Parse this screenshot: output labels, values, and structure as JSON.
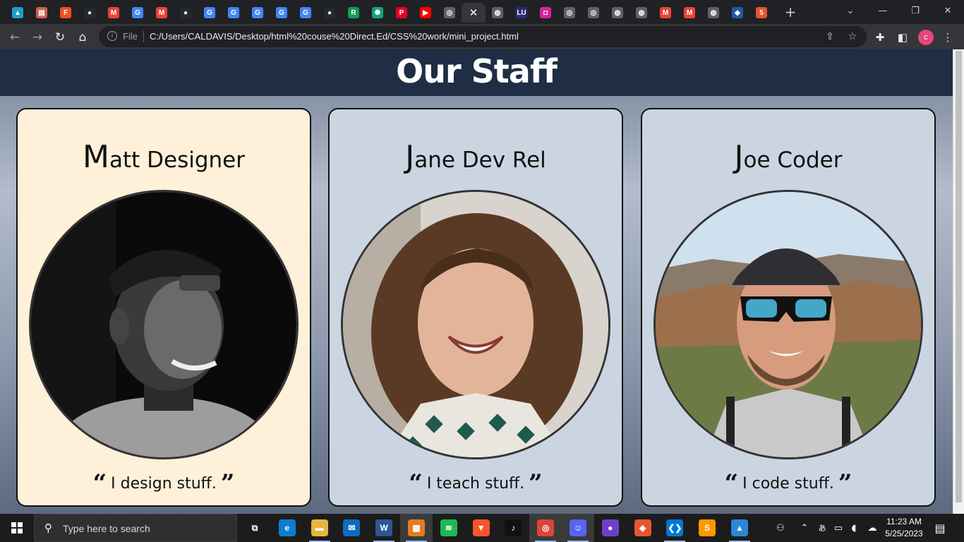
{
  "browser": {
    "tab_close_glyph": "✕",
    "new_tab_glyph": "+",
    "tabs": [
      {
        "icon": "meet-icon",
        "color": "#1aa0c8",
        "glyph": "▲"
      },
      {
        "icon": "notes-icon",
        "color": "#c9634d",
        "glyph": "▤"
      },
      {
        "icon": "figma-icon",
        "color": "#f24e1e",
        "glyph": "F"
      },
      {
        "icon": "github-icon",
        "color": "#24292e",
        "glyph": "●"
      },
      {
        "icon": "gmail-icon",
        "color": "#ea4335",
        "glyph": "M"
      },
      {
        "icon": "google-icon",
        "color": "#4285f4",
        "glyph": "G"
      },
      {
        "icon": "gmail-icon",
        "color": "#ea4335",
        "glyph": "M"
      },
      {
        "icon": "github-icon",
        "color": "#24292e",
        "glyph": "●"
      },
      {
        "icon": "google-icon",
        "color": "#4285f4",
        "glyph": "G"
      },
      {
        "icon": "google-icon",
        "color": "#4285f4",
        "glyph": "G"
      },
      {
        "icon": "google-icon",
        "color": "#4285f4",
        "glyph": "G"
      },
      {
        "icon": "google-icon",
        "color": "#4285f4",
        "glyph": "G"
      },
      {
        "icon": "google-icon",
        "color": "#4285f4",
        "glyph": "G"
      },
      {
        "icon": "github-icon",
        "color": "#24292e",
        "glyph": "●"
      },
      {
        "icon": "replit-icon",
        "color": "#0f9d58",
        "glyph": "R"
      },
      {
        "icon": "chatgpt-icon",
        "color": "#10a37f",
        "glyph": "✺"
      },
      {
        "icon": "pinterest-icon",
        "color": "#e60023",
        "glyph": "P"
      },
      {
        "icon": "youtube-icon",
        "color": "#ff0000",
        "glyph": "▶"
      },
      {
        "icon": "chrome-icon",
        "color": "#5f6368",
        "glyph": "◎"
      },
      {
        "icon": "active-tab-close-icon",
        "color": "#35363a",
        "glyph": "✕"
      },
      {
        "icon": "globe-icon",
        "color": "#5f6368",
        "glyph": "◍"
      },
      {
        "icon": "lu-icon",
        "color": "#2b2b7a",
        "glyph": "LU"
      },
      {
        "icon": "instagram-icon",
        "color": "#d6249f",
        "glyph": "◘"
      },
      {
        "icon": "chrome-icon",
        "color": "#5f6368",
        "glyph": "◎"
      },
      {
        "icon": "chrome-icon",
        "color": "#5f6368",
        "glyph": "◎"
      },
      {
        "icon": "globe-icon",
        "color": "#5f6368",
        "glyph": "◍"
      },
      {
        "icon": "globe-icon",
        "color": "#5f6368",
        "glyph": "◍"
      },
      {
        "icon": "gmail-icon",
        "color": "#ea4335",
        "glyph": "M"
      },
      {
        "icon": "gmail-icon",
        "color": "#ea4335",
        "glyph": "M"
      },
      {
        "icon": "globe-icon",
        "color": "#5f6368",
        "glyph": "◍"
      },
      {
        "icon": "app-icon",
        "color": "#1f5aa6",
        "glyph": "◆"
      },
      {
        "icon": "html-icon",
        "color": "#e5532d",
        "glyph": "5"
      }
    ],
    "omnibox": {
      "info_glyph": "i",
      "scheme_label": "File",
      "url": "C:/Users/CALDAVIS/Desktop/html%20couse%20Direct.Ed/CSS%20work/mini_project.html"
    },
    "profile_initial": "c"
  },
  "page": {
    "title": "Our Staff",
    "staff": [
      {
        "initial": "M",
        "name_rest": "att Designer",
        "quote": "I design stuff.",
        "card_color": "#fef0d9"
      },
      {
        "initial": "J",
        "name_rest": "ane Dev Rel",
        "quote": "I teach stuff.",
        "card_color": "#cbd5e2"
      },
      {
        "initial": "J",
        "name_rest": "oe Coder",
        "quote": "I code stuff.",
        "card_color": "#cbd5e2"
      }
    ],
    "open_quote": "“",
    "close_quote": "”"
  },
  "taskbar": {
    "search_placeholder": "Type here to search",
    "time": "11:23 AM",
    "date": "5/25/2023",
    "apps": [
      {
        "icon": "task-view-icon",
        "color": "#1c1c1c",
        "glyph": "⧉"
      },
      {
        "icon": "edge-icon",
        "color": "#0c7fd1",
        "glyph": "e"
      },
      {
        "icon": "file-explorer-icon",
        "color": "#e8b53f",
        "glyph": "▬"
      },
      {
        "icon": "mail-icon",
        "color": "#0f6cbd",
        "glyph": "✉"
      },
      {
        "icon": "word-icon",
        "color": "#2b579a",
        "glyph": "W"
      },
      {
        "icon": "store-icon",
        "color": "#e57a23",
        "glyph": "▦"
      },
      {
        "icon": "spotify-icon",
        "color": "#1db954",
        "glyph": "≋"
      },
      {
        "icon": "brave-icon",
        "color": "#fb542b",
        "glyph": "▼"
      },
      {
        "icon": "tiktok-icon",
        "color": "#111111",
        "glyph": "♪"
      },
      {
        "icon": "chrome-icon",
        "color": "#db4437",
        "glyph": "◎"
      },
      {
        "icon": "discord-icon",
        "color": "#5865f2",
        "glyph": "☺"
      },
      {
        "icon": "github-desktop-icon",
        "color": "#6e40c9",
        "glyph": "●"
      },
      {
        "icon": "git-icon",
        "color": "#e4572e",
        "glyph": "◈"
      },
      {
        "icon": "vscode-icon",
        "color": "#0078d4",
        "glyph": "❮❯"
      },
      {
        "icon": "sublime-icon",
        "color": "#ff9800",
        "glyph": "S"
      },
      {
        "icon": "photos-icon",
        "color": "#2b88d8",
        "glyph": "▲"
      }
    ]
  }
}
